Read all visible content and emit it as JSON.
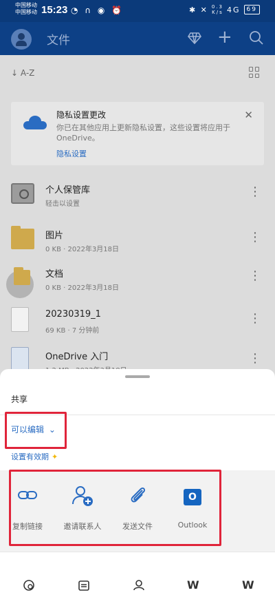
{
  "status": {
    "carrier_top": "中国移动",
    "carrier_bottom": "中国移动",
    "time": "15:23",
    "left_icons": "◔ ∩ ◉ ⏰",
    "right_icons": "✱ ✕",
    "speed_top": "0.3",
    "speed_bottom": "K/s",
    "signal_text": "4G",
    "battery": "69"
  },
  "appbar": {
    "title": "文件",
    "icons": [
      "diamond-icon",
      "plus-icon",
      "search-icon"
    ]
  },
  "sort": {
    "label": "↓ A-Z"
  },
  "banner": {
    "title": "隐私设置更改",
    "text": "你已在其他应用上更新隐私设置，这些设置将应用于 OneDrive。",
    "link": "隐私设置"
  },
  "files": [
    {
      "name": "个人保管库",
      "meta": "轻击以设置",
      "icon": "vault-icon"
    },
    {
      "name": "图片",
      "meta": "0 KB · 2022年3月18日",
      "icon": "folder-icon"
    },
    {
      "name": "文档",
      "meta": "0 KB · 2022年3月18日",
      "icon": "folder-icon"
    },
    {
      "name": "20230319_1",
      "meta": "69 KB · 7 分钟前",
      "icon": "document-icon"
    },
    {
      "name": "OneDrive 入门",
      "meta": "1.2 MB · 2022年3月18日",
      "icon": "pdf-icon"
    }
  ],
  "sheet": {
    "title": "共享",
    "permission": "可以编辑",
    "expiry": "设置有效期",
    "actions": [
      {
        "label": "复制链接",
        "icon": "link-icon"
      },
      {
        "label": "邀请联系人",
        "icon": "add-person-icon"
      },
      {
        "label": "发送文件",
        "icon": "paperclip-icon"
      },
      {
        "label": "Outlook",
        "icon": "outlook-icon"
      }
    ]
  },
  "tabs": [
    "home-icon",
    "files-icon",
    "shared-icon",
    "wps-icon",
    "wps2-icon"
  ],
  "colors": {
    "accent": "#2a6cc2",
    "appbar": "#0d4086",
    "highlight": "#e0243a"
  }
}
